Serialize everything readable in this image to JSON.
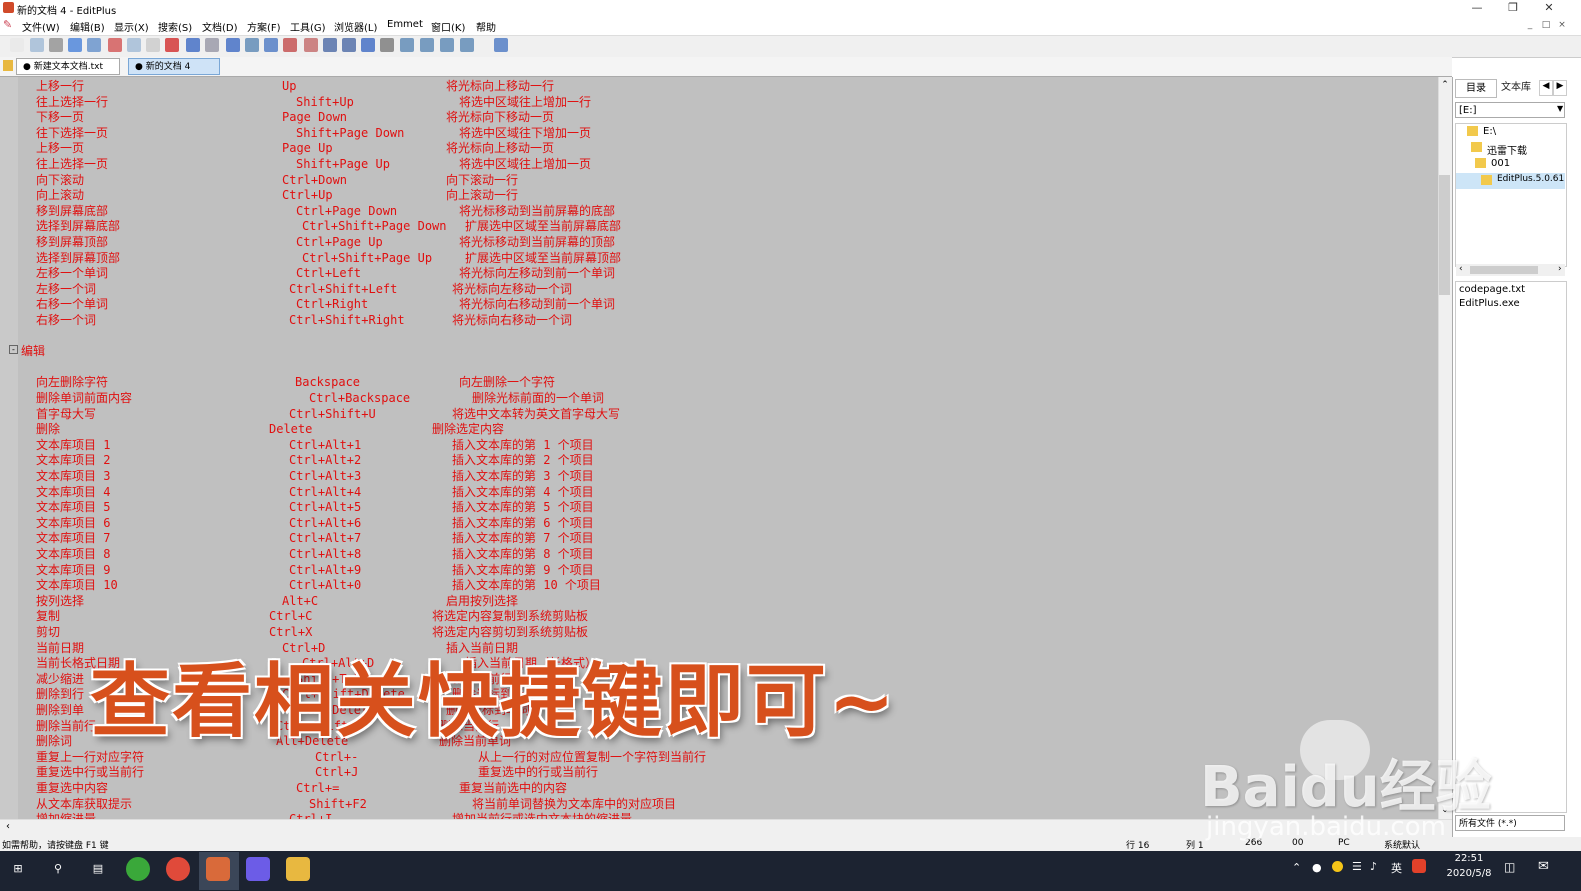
{
  "window": {
    "title": "新的文档 4 - EditPlus"
  },
  "menu": [
    "文件(W)",
    "编辑(B)",
    "显示(X)",
    "搜索(S)",
    "文档(D)",
    "方案(F)",
    "工具(G)",
    "浏览器(L)",
    "Emmet",
    "窗口(K)",
    "帮助"
  ],
  "tabs": [
    "新建文本文档.txt",
    "新的文档 4"
  ],
  "lines": [
    {
      "a": "上移一行",
      "b": "Up",
      "c": "将光标向上移动一行"
    },
    {
      "a": "往上选择一行",
      "b": "Shift+Up",
      "c": "将选中区域往上增加一行"
    },
    {
      "a": "下移一页",
      "b": "Page Down",
      "c": "将光标向下移动一页"
    },
    {
      "a": "往下选择一页",
      "b": "Shift+Page Down",
      "c": "将选中区域往下增加一页"
    },
    {
      "a": "上移一页",
      "b": "Page Up",
      "c": "将光标向上移动一页"
    },
    {
      "a": "往上选择一页",
      "b": "Shift+Page Up",
      "c": "将选中区域往上增加一页"
    },
    {
      "a": "向下滚动",
      "b": "Ctrl+Down",
      "c": "向下滚动一行"
    },
    {
      "a": "向上滚动",
      "b": "Ctrl+Up",
      "c": "向上滚动一行"
    },
    {
      "a": "移到屏幕底部",
      "b": "Ctrl+Page Down",
      "c": "将光标移动到当前屏幕的底部"
    },
    {
      "a": "选择到屏幕底部",
      "b": "Ctrl+Shift+Page Down",
      "c": "扩展选中区域至当前屏幕底部"
    },
    {
      "a": "移到屏幕顶部",
      "b": "Ctrl+Page Up",
      "c": "将光标移动到当前屏幕的顶部"
    },
    {
      "a": "选择到屏幕顶部",
      "b": "Ctrl+Shift+Page Up",
      "c": "扩展选中区域至当前屏幕顶部"
    },
    {
      "a": "左移一个单词",
      "b": "Ctrl+Left",
      "c": "将光标向左移动到前一个单词"
    },
    {
      "a": "左移一个词",
      "b": "Ctrl+Shift+Left",
      "c": "将光标向左移动一个词"
    },
    {
      "a": "右移一个单词",
      "b": "Ctrl+Right",
      "c": "将光标向右移动到前一个单词"
    },
    {
      "a": "右移一个词",
      "b": "Ctrl+Shift+Right",
      "c": "将光标向右移动一个词"
    },
    {
      "a": "",
      "b": "",
      "c": ""
    },
    {
      "a": "编辑",
      "b": "",
      "c": ""
    },
    {
      "a": "",
      "b": "",
      "c": ""
    },
    {
      "a": "向左删除字符",
      "b": "Backspace",
      "c": "向左删除一个字符"
    },
    {
      "a": "删除单词前面内容",
      "b": "Ctrl+Backspace",
      "c": "删除光标前面的一个单词"
    },
    {
      "a": "首字母大写",
      "b": "Ctrl+Shift+U",
      "c": "将选中文本转为英文首字母大写"
    },
    {
      "a": "删除",
      "b": "Delete",
      "c": "删除选定内容"
    },
    {
      "a": "文本库项目 1",
      "b": "Ctrl+Alt+1",
      "c": "插入文本库的第 1 个项目"
    },
    {
      "a": "文本库项目 2",
      "b": "Ctrl+Alt+2",
      "c": "插入文本库的第 2 个项目"
    },
    {
      "a": "文本库项目 3",
      "b": "Ctrl+Alt+3",
      "c": "插入文本库的第 3 个项目"
    },
    {
      "a": "文本库项目 4",
      "b": "Ctrl+Alt+4",
      "c": "插入文本库的第 4 个项目"
    },
    {
      "a": "文本库项目 5",
      "b": "Ctrl+Alt+5",
      "c": "插入文本库的第 5 个项目"
    },
    {
      "a": "文本库项目 6",
      "b": "Ctrl+Alt+6",
      "c": "插入文本库的第 6 个项目"
    },
    {
      "a": "文本库项目 7",
      "b": "Ctrl+Alt+7",
      "c": "插入文本库的第 7 个项目"
    },
    {
      "a": "文本库项目 8",
      "b": "Ctrl+Alt+8",
      "c": "插入文本库的第 8 个项目"
    },
    {
      "a": "文本库项目 9",
      "b": "Ctrl+Alt+9",
      "c": "插入文本库的第 9 个项目"
    },
    {
      "a": "文本库项目 10",
      "b": "Ctrl+Alt+0",
      "c": "插入文本库的第 10 个项目"
    },
    {
      "a": "按列选择",
      "b": "Alt+C",
      "c": "启用按列选择"
    },
    {
      "a": "复制",
      "b": "Ctrl+C",
      "c": "将选定内容复制到系统剪贴板"
    },
    {
      "a": "剪切",
      "b": "Ctrl+X",
      "c": "将选定内容剪切到系统剪贴板"
    },
    {
      "a": "当前日期",
      "b": "Ctrl+D",
      "c": "插入当前日期"
    },
    {
      "a": "当前长格式日期",
      "b": "Ctrl+Alt+D",
      "c": "插入当前日期（长格式）"
    },
    {
      "a": "减少缩进",
      "b": "Shift+Tab",
      "c": "减少当前行的缩进"
    },
    {
      "a": "删除到行",
      "b": "Ctrl+Shift+Delete",
      "c": "删除光标到行尾的字符"
    },
    {
      "a": "删除到单",
      "b": "Ctrl+Delete",
      "c": "删除光标到单词尾"
    },
    {
      "a": "删除当前行",
      "b": "Ctrl+Shift+Y",
      "c": "删除当前行"
    },
    {
      "a": "删除词",
      "b": "Alt+Delete",
      "c": "删除当前单词"
    },
    {
      "a": "重复上一行对应字符",
      "b": "Ctrl+-",
      "c": "从上一行的对应位置复制一个字符到当前行"
    },
    {
      "a": "重复选中行或当前行",
      "b": "Ctrl+J",
      "c": "重复选中的行或当前行"
    },
    {
      "a": "重复选中内容",
      "b": "Ctrl+=",
      "c": "重复当前选中的内容"
    },
    {
      "a": "从文本库获取提示",
      "b": "Shift+F2",
      "c": "将当前单词替换为文本库中的对应项目"
    },
    {
      "a": "增加缩进量",
      "b": "Ctrl+I",
      "c": "增加当前行或选中文本块的缩进量"
    }
  ],
  "sidebar": {
    "tabs": [
      "目录",
      "文本库"
    ],
    "drive": "[E:]",
    "tree": [
      "E:\\",
      "迅雷下载",
      "001",
      "EditPlus.5.0.611"
    ],
    "files": [
      "codepage.txt",
      "EditPlus.exe"
    ],
    "filter": "所有文件 (*.*)"
  },
  "status": {
    "help": "如需帮助，请按键盘 F1 键",
    "row": "行 16",
    "col": "列 1",
    "num1": "266",
    "num2": "00",
    "mode": "PC",
    "encoding": "系统默认"
  },
  "taskbar": {
    "time": "22:51",
    "date": "2020/5/8",
    "ime": "英"
  },
  "overlay": {
    "caption": "查看相关快捷键即可~",
    "watermark_brand": "Baidu经验",
    "watermark_url": "jingyan.baidu.com"
  },
  "colors": {
    "code_text": "#e01010",
    "editor_bg": "#c0c0c0",
    "caption": "#d7501c"
  }
}
